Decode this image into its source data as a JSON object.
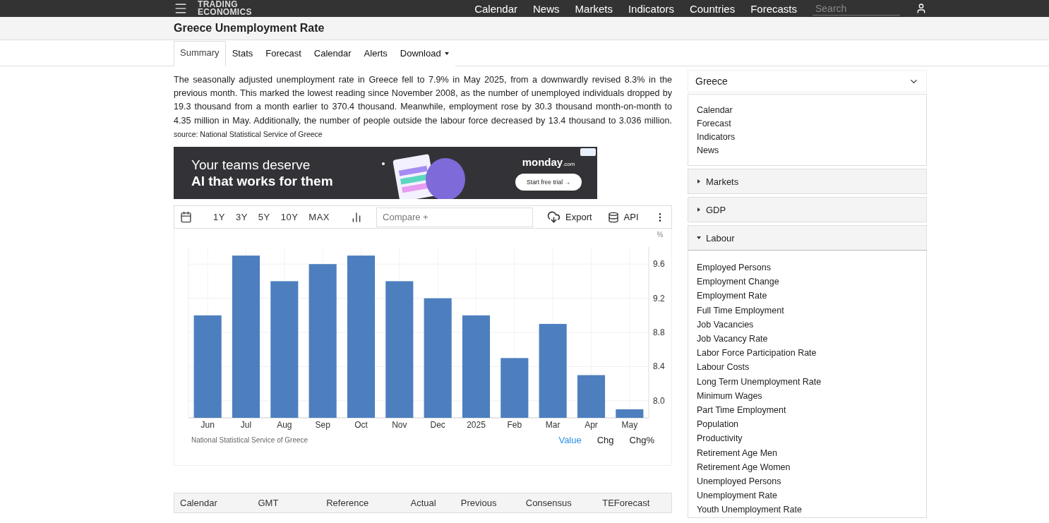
{
  "navbar": {
    "logo": [
      "TRADING",
      "ECONOMICS"
    ],
    "links": [
      "Calendar",
      "News",
      "Markets",
      "Indicators",
      "Countries",
      "Forecasts"
    ],
    "search": {
      "placeholder": "Search"
    }
  },
  "page_title": "Greece Unemployment Rate",
  "tabs": [
    {
      "label": "Summary",
      "selected": true
    },
    {
      "label": "Stats",
      "selected": false
    },
    {
      "label": "Forecast",
      "selected": false
    },
    {
      "label": "Calendar",
      "selected": false
    },
    {
      "label": "Alerts",
      "selected": false
    },
    {
      "label": "Download",
      "selected": false,
      "dropdown": true
    }
  ],
  "summary": {
    "text": "The seasonally adjusted unemployment rate in Greece fell to 7.9% in May 2025, from a downwardly revised 8.3% in the previous month. This marked the lowest reading since November 2008, as the number of unemployed individuals dropped by 19.3 thousand from a month earlier to 370.4 thousand. Meanwhile, employment rose by 30.3 thousand month-on-month to 4.35 million in May. Additionally, the number of people outside the labour force decreased by 13.4 thousand to 3.036 million.",
    "source": "source: National Statistical Service of Greece"
  },
  "ad": {
    "headline": "Your teams deserve",
    "subline": "AI that works for them",
    "brand": "monday",
    "brand_suffix": ".com",
    "cta": "Start free trial →"
  },
  "chart_toolbar": {
    "ranges": [
      "1Y",
      "3Y",
      "5Y",
      "10Y",
      "MAX"
    ],
    "compare_placeholder": "Compare +",
    "export": "Export",
    "api": "API"
  },
  "chart": {
    "unit": "%",
    "source": "National Statistical Service of Greece",
    "modes": [
      {
        "label": "Value",
        "selected": true
      },
      {
        "label": "Chg",
        "selected": false
      },
      {
        "label": "Chg%",
        "selected": false
      }
    ],
    "chart_data": {
      "type": "bar",
      "categories": [
        "Jun",
        "Jul",
        "Aug",
        "Sep",
        "Oct",
        "Nov",
        "Dec",
        "2025",
        "Feb",
        "Mar",
        "Apr",
        "May"
      ],
      "grid": true,
      "series": [
        {
          "color": "#4d7fbf",
          "values": [
            9.0,
            9.7,
            9.4,
            9.6,
            9.7,
            9.4,
            9.2,
            9.0,
            8.5,
            8.9,
            8.3,
            7.9
          ]
        }
      ],
      "ylim": [
        7.8,
        9.8
      ],
      "yticks": [
        {
          "value": 8,
          "label": "8.0"
        },
        {
          "value": 8.4,
          "label": "8.4"
        },
        {
          "value": 8.8,
          "label": "8.8"
        },
        {
          "value": 9.2,
          "label": "9.2"
        },
        {
          "value": 9.6,
          "label": "9.6"
        }
      ]
    }
  },
  "calendar_table": {
    "columns": [
      "Calendar",
      "GMT",
      "Reference",
      "Actual",
      "Previous",
      "Consensus",
      "TEForecast"
    ]
  },
  "sidebar": {
    "country": "Greece",
    "links": [
      "Calendar",
      "Forecast",
      "Indicators",
      "News"
    ],
    "sections": [
      {
        "title": "Markets",
        "expanded": false
      },
      {
        "title": "GDP",
        "expanded": false
      },
      {
        "title": "Labour",
        "expanded": true,
        "items": [
          "Employed Persons",
          "Employment Change",
          "Employment Rate",
          "Full Time Employment",
          "Job Vacancies",
          "Job Vacancy Rate",
          "Labor Force Participation Rate",
          "Labour Costs",
          "Long Term Unemployment Rate",
          "Minimum Wages",
          "Part Time Employment",
          "Population",
          "Productivity",
          "Retirement Age Men",
          "Retirement Age Women",
          "Unemployed Persons",
          "Unemployment Rate",
          "Youth Unemployment Rate"
        ]
      }
    ]
  }
}
